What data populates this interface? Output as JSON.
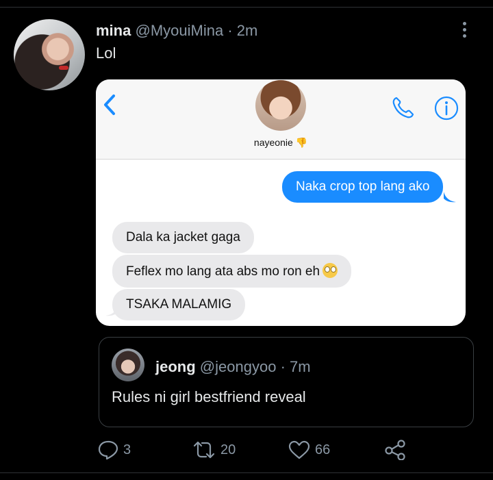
{
  "tweet": {
    "name": "mina",
    "handle": "@MyouiMina",
    "separator": "·",
    "time": "2m",
    "text": "Lol"
  },
  "screenshot": {
    "contact_name": "nayeonie 👎",
    "messages": [
      {
        "direction": "outgoing",
        "text": "Naka crop top lang ako"
      },
      {
        "direction": "incoming",
        "text": "Dala ka jacket gaga"
      },
      {
        "direction": "incoming",
        "text": "Feflex mo lang ata abs mo ron eh"
      },
      {
        "direction": "incoming",
        "text": "TSAKA MALAMIG"
      }
    ],
    "colors": {
      "outgoing": "#1a8cff",
      "incoming": "#e9e9eb",
      "accent": "#1a8cff"
    },
    "icons": [
      "chevron-left-icon",
      "phone-icon",
      "info-icon",
      "eye-roll-emoji"
    ]
  },
  "quote": {
    "name": "jeong",
    "handle": "@jeongyoo",
    "separator": "·",
    "time": "7m",
    "text": "Rules ni girl bestfriend reveal"
  },
  "actions": {
    "replies": "3",
    "retweets": "20",
    "likes": "66",
    "icons": [
      "reply-icon",
      "retweet-icon",
      "like-icon",
      "share-icon"
    ]
  }
}
